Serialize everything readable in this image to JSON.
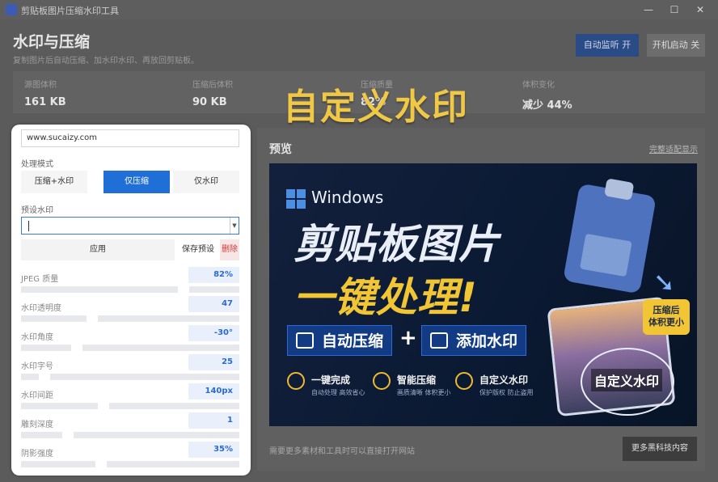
{
  "window": {
    "title": "剪贴板图片压缩水印工具",
    "controls": [
      "—",
      "☐",
      "✕"
    ]
  },
  "header": {
    "title": "水印与压缩",
    "subtitle": "复制图片后自动压缩、加水印水印、再放回剪贴板。",
    "auto_monitor_button": "自动监听 开",
    "startup_button": "开机启动 关"
  },
  "stats": [
    {
      "label": "源图体积",
      "value": "161 KB"
    },
    {
      "label": "压缩后体积",
      "value": "90 KB"
    },
    {
      "label": "压缩质量",
      "value": "82%"
    },
    {
      "label": "体积变化",
      "value": "减少 44%"
    }
  ],
  "overlay_title": "自定义水印",
  "panel": {
    "source_text": "www.sucaizy.com",
    "mode_label": "处理模式",
    "modes": [
      {
        "label": "压缩+水印",
        "active": false
      },
      {
        "label": "仅压缩",
        "active": true
      },
      {
        "label": "仅水印",
        "active": false
      }
    ],
    "preset_label": "预设水印",
    "preset_value": "",
    "apply_button": "应用",
    "save_button": "保存预设",
    "delete_button": "删除",
    "sliders": [
      {
        "label": "JPEG 质量",
        "value": "82%",
        "fill": 0.72
      },
      {
        "label": "水印透明度",
        "value": "47",
        "fill": 0.3
      },
      {
        "label": "水印角度",
        "value": "-30°",
        "fill": 0.23
      },
      {
        "label": "水印字号",
        "value": "25",
        "fill": 0.08
      },
      {
        "label": "水印间距",
        "value": "140px",
        "fill": 0.35
      },
      {
        "label": "雕刻深度",
        "value": "1",
        "fill": 0.19
      },
      {
        "label": "阴影强度",
        "value": "35%",
        "fill": 0.34
      }
    ]
  },
  "preview": {
    "title": "预览",
    "link": "完整适配显示",
    "footer_text": "需要更多素材和工具时可以直接打开网站",
    "more_button": "更多黑科技内容",
    "image": {
      "windows_label": "Windows",
      "headline_1": "剪贴板图片",
      "headline_2": "一键处理!",
      "tag_1": "自动压缩",
      "plus": "+",
      "tag_2": "添加水印",
      "badge_line1": "压缩后",
      "badge_line2": "体积更小",
      "stamp_text": "自定义水印",
      "features": [
        {
          "title": "一键完成",
          "desc": "自动处理 高效省心",
          "icon": "lightning-icon"
        },
        {
          "title": "智能压缩",
          "desc": "画质清晰 体积更小",
          "icon": "target-icon"
        },
        {
          "title": "自定义水印",
          "desc": "保护版权 防止盗用",
          "icon": "shield-check-icon"
        }
      ]
    }
  },
  "colors": {
    "accent": "#1f6fd6",
    "overlay_gold": "#f0c845",
    "delete_red": "#d23b3b"
  }
}
